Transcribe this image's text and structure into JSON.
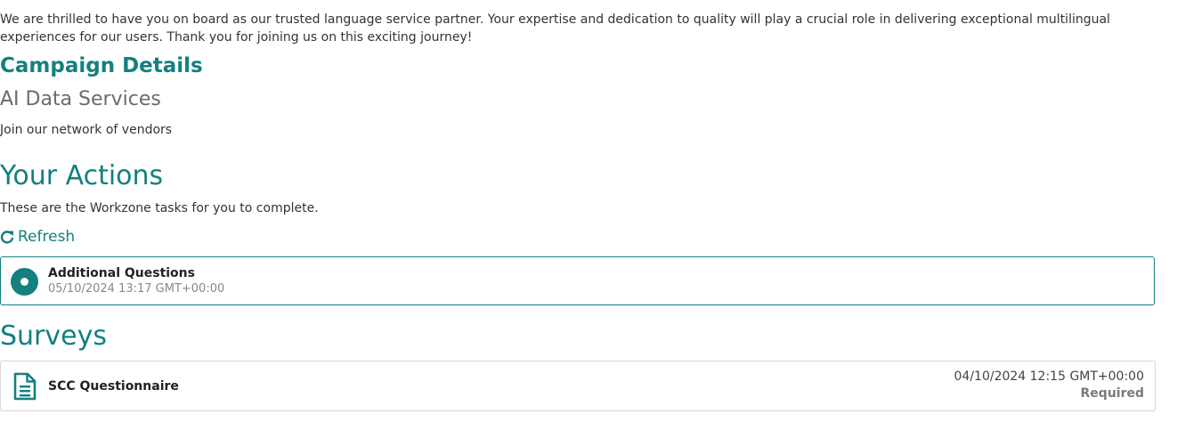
{
  "intro": {
    "text": "We are thrilled to have you on board as our trusted language service partner. Your expertise and dedication to quality will play a crucial role in delivering exceptional multilingual experiences for our users. Thank you for joining us on this exciting journey!"
  },
  "campaign": {
    "heading": "Campaign Details",
    "name": "AI Data Services",
    "description": "Join our network of vendors"
  },
  "actions": {
    "heading": "Your Actions",
    "description": "These are the Workzone tasks for you to complete.",
    "refresh_label": "Refresh",
    "items": [
      {
        "title": "Additional Questions",
        "timestamp": "05/10/2024 13:17 GMT+00:00",
        "status_icon": "radio-dot-icon"
      }
    ]
  },
  "surveys": {
    "heading": "Surveys",
    "items": [
      {
        "title": "SCC Questionnaire",
        "timestamp": "04/10/2024 12:15 GMT+00:00",
        "status": "Required",
        "icon": "document-icon"
      }
    ]
  },
  "colors": {
    "accent": "#14807f",
    "muted": "#888888",
    "border": "#d7d7d7"
  }
}
